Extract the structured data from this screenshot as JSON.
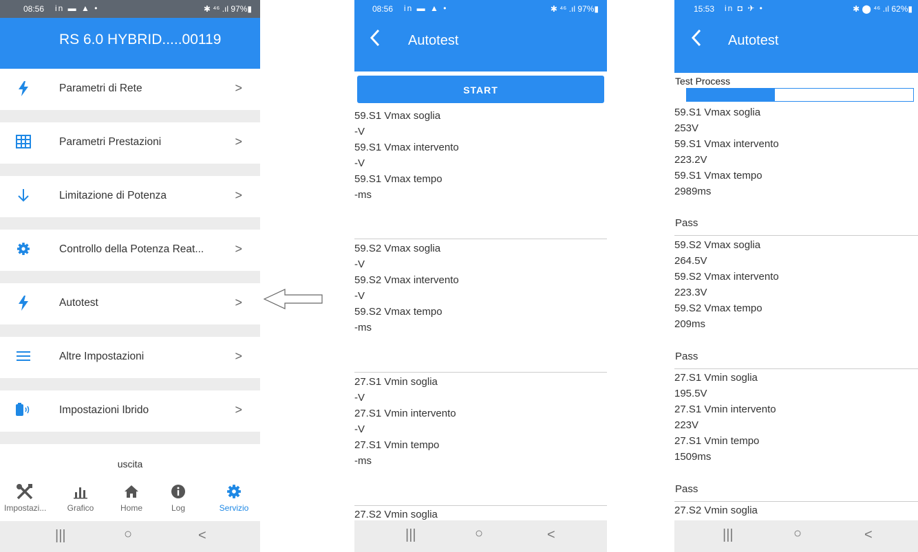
{
  "phone1": {
    "status": {
      "time": "08:56",
      "icons": "in ▬ ▲ •",
      "right": "✱ ⁴⁶ .ıl 97%▮"
    },
    "app_title": "RS 6.0 HYBRID.....00119",
    "menu": [
      {
        "icon": "bolt-icon",
        "label": "Parametri di Rete"
      },
      {
        "icon": "grid-icon",
        "label": "Parametri Prestazioni"
      },
      {
        "icon": "arrow-down-icon",
        "label": "Limitazione di Potenza"
      },
      {
        "icon": "gear-icon",
        "label": "Controllo della Potenza Reat..."
      },
      {
        "icon": "bolt-icon",
        "label": "Autotest"
      },
      {
        "icon": "menu-icon",
        "label": "Altre Impostazioni"
      },
      {
        "icon": "battery-icon",
        "label": "Impostazioni Ibrido"
      }
    ],
    "exit_label": "uscita",
    "tabs": [
      {
        "icon": "tools-icon",
        "label": "Impostazi..."
      },
      {
        "icon": "chart-icon",
        "label": "Grafico"
      },
      {
        "icon": "home-icon",
        "label": "Home"
      },
      {
        "icon": "info-icon",
        "label": "Log"
      },
      {
        "icon": "gear-icon",
        "label": "Servizio"
      }
    ],
    "active_tab": "Servizio"
  },
  "phone2": {
    "status": {
      "time": "08:56",
      "icons": "in ▬ ▲ •",
      "right": "✱ ⁴⁶ .ıl 97%▮"
    },
    "title": "Autotest",
    "start_label": "START",
    "blocks": [
      {
        "lines": [
          "59.S1 Vmax soglia",
          "-V",
          "59.S1 Vmax intervento",
          "-V",
          "59.S1 Vmax tempo",
          "-ms"
        ]
      },
      {
        "lines": [
          "59.S2 Vmax soglia",
          "-V",
          "59.S2 Vmax intervento",
          "-V",
          "59.S2 Vmax tempo",
          "-ms"
        ]
      },
      {
        "lines": [
          "27.S1 Vmin soglia",
          "-V",
          "27.S1 Vmin intervento",
          "-V",
          "27.S1 Vmin tempo",
          "-ms"
        ]
      },
      {
        "lines": [
          "27.S2 Vmin soglia"
        ]
      }
    ]
  },
  "phone3": {
    "status": {
      "time": "15:53",
      "icons": "in ◘ ✈ •",
      "right": "✱ ⬤ ⁴⁶ .ıl 62%▮"
    },
    "title": "Autotest",
    "progress_label": "Test Process",
    "progress": 0.39,
    "blocks": [
      {
        "lines": [
          "59.S1 Vmax soglia",
          "253V",
          "59.S1 Vmax intervento",
          "223.2V",
          "59.S1 Vmax tempo",
          "2989ms"
        ],
        "result": "Pass"
      },
      {
        "lines": [
          "59.S2 Vmax soglia",
          "264.5V",
          "59.S2 Vmax intervento",
          "223.3V",
          "59.S2 Vmax tempo",
          "209ms"
        ],
        "result": "Pass"
      },
      {
        "lines": [
          "27.S1 Vmin soglia",
          "195.5V",
          "27.S1 Vmin intervento",
          "223V",
          "27.S1 Vmin tempo",
          "1509ms"
        ],
        "result": "Pass"
      },
      {
        "lines": [
          "27.S2 Vmin soglia"
        ]
      }
    ]
  },
  "nav": {
    "recent": "|||",
    "home": "○",
    "back": "<"
  },
  "colors": {
    "accent": "#2a8cf0",
    "status_gray": "#5e6670",
    "separator": "#ececec"
  }
}
